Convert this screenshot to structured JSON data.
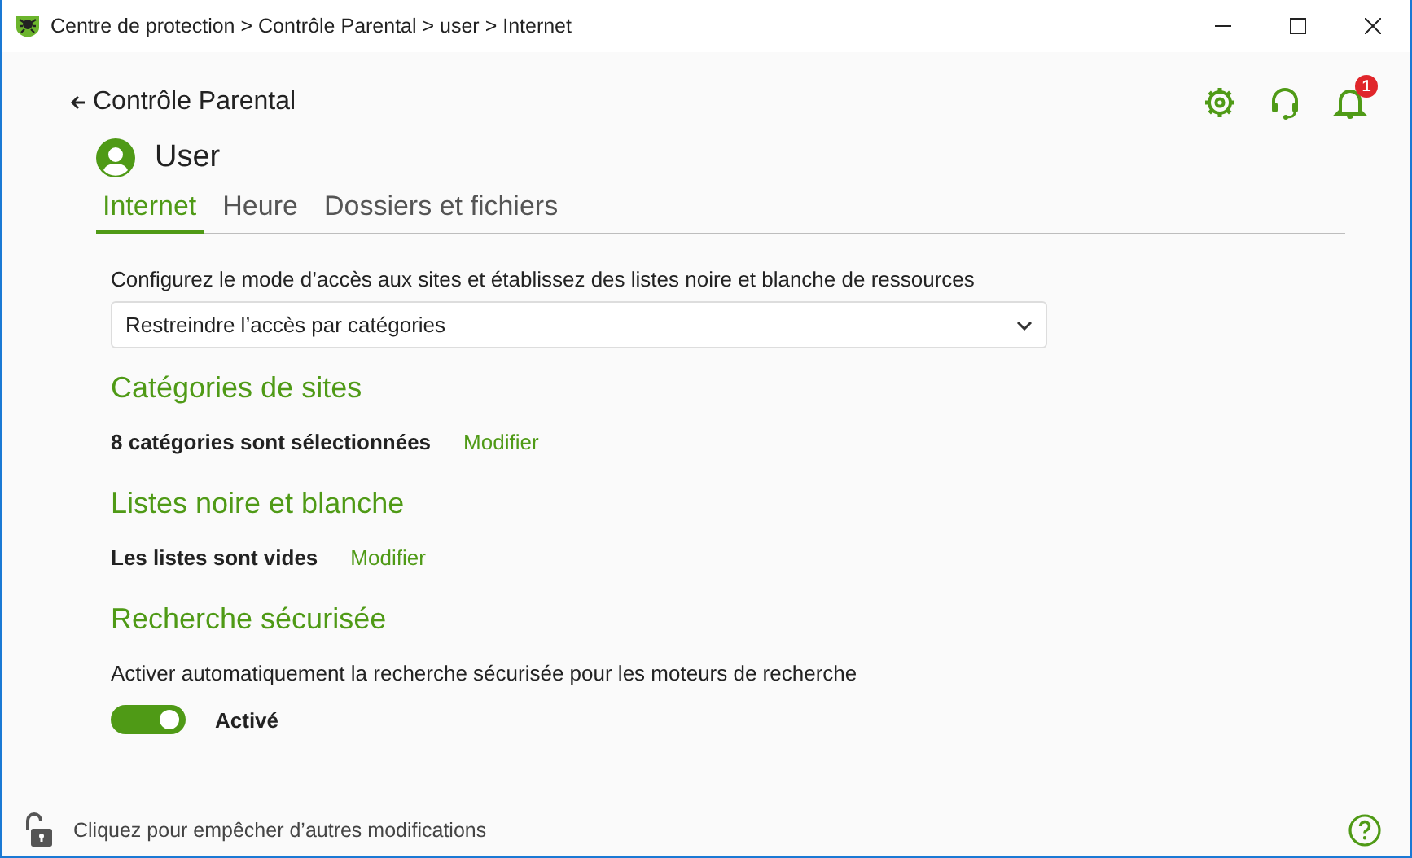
{
  "window": {
    "title": "Centre de protection > Contrôle Parental > user > Internet"
  },
  "header": {
    "back": "Contrôle Parental",
    "notification_count": "1"
  },
  "user": {
    "name": "User"
  },
  "tabs": [
    {
      "label": "Internet",
      "selected": true
    },
    {
      "label": "Heure",
      "selected": false
    },
    {
      "label": "Dossiers et fichiers",
      "selected": false
    }
  ],
  "access": {
    "description": "Configurez le mode d’accès aux sites et établissez des listes noire et blanche de ressources",
    "dropdown_value": "Restreindre l’accès par catégories"
  },
  "sections": [
    {
      "title": "Catégories de sites",
      "kind": "status",
      "status": "8 catégories sont sélectionnées",
      "link": "Modifier"
    },
    {
      "title": "Listes noire et blanche",
      "kind": "status",
      "status": "Les listes sont vides",
      "link": "Modifier"
    },
    {
      "title": "Recherche sécurisée",
      "kind": "toggle",
      "description": "Activer automatiquement la recherche sécurisée pour les moteurs de recherche",
      "on": true,
      "toggle_label": "Activé"
    }
  ],
  "footer": {
    "lock_text": "Cliquez pour empêcher d’autres modifications"
  }
}
